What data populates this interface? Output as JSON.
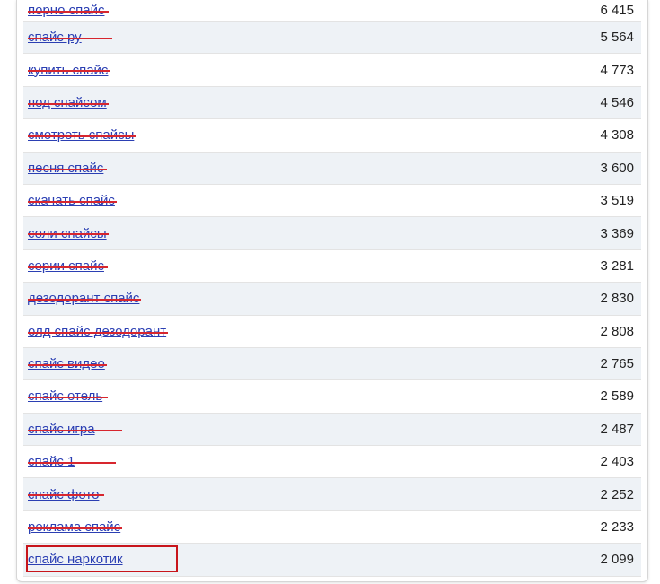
{
  "colors": {
    "link": "#2b3fb3",
    "strike": "#d7262e",
    "highlight": "#c8151b",
    "row_alt": "#eef2f6"
  },
  "rows": [
    {
      "phrase": "порно спайс",
      "count": "6 415",
      "struck": true
    },
    {
      "phrase": "спайс ру",
      "count": "5 564",
      "struck": true
    },
    {
      "phrase": "купить спайс",
      "count": "4 773",
      "struck": true
    },
    {
      "phrase": "под спайсом",
      "count": "4 546",
      "struck": true
    },
    {
      "phrase": "смотреть спайсы",
      "count": "4 308",
      "struck": true
    },
    {
      "phrase": "песня спайс",
      "count": "3 600",
      "struck": true
    },
    {
      "phrase": "скачать спайс",
      "count": "3 519",
      "struck": true
    },
    {
      "phrase": "соли спайсы",
      "count": "3 369",
      "struck": true
    },
    {
      "phrase": "серии спайс",
      "count": "3 281",
      "struck": true
    },
    {
      "phrase": "дезодорант спайс",
      "count": "2 830",
      "struck": true
    },
    {
      "phrase": "олд спайс дезодорант",
      "count": "2 808",
      "struck": true
    },
    {
      "phrase": "спайс видео",
      "count": "2 765",
      "struck": true
    },
    {
      "phrase": "спайс отель",
      "count": "2 589",
      "struck": true
    },
    {
      "phrase": "спайс игра",
      "count": "2 487",
      "struck": true
    },
    {
      "phrase": "спайс 1",
      "count": "2 403",
      "struck": true
    },
    {
      "phrase": "спайс фото",
      "count": "2 252",
      "struck": true
    },
    {
      "phrase": "реклама спайс",
      "count": "2 233",
      "struck": true
    },
    {
      "phrase": "спайс наркотик",
      "count": "2 099",
      "struck": false,
      "highlighted": true
    }
  ]
}
